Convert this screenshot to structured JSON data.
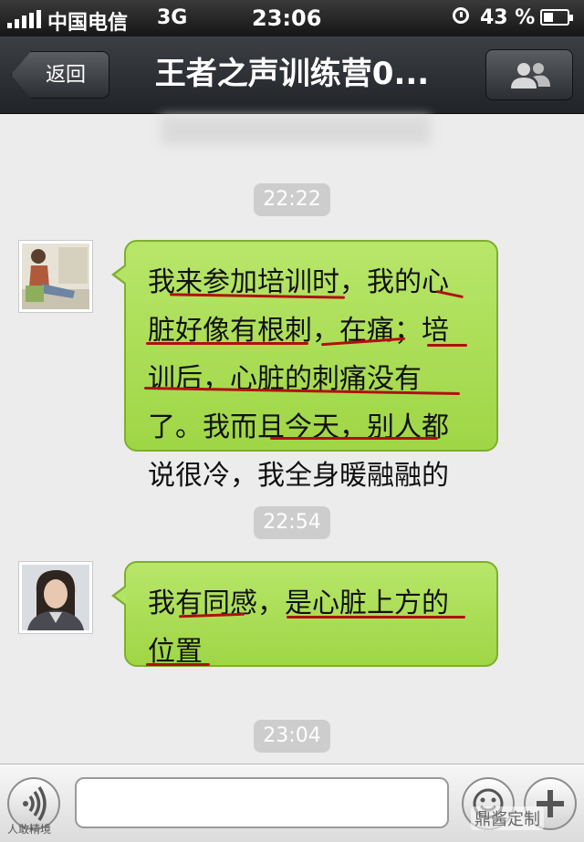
{
  "status_bar": {
    "carrier": "中国电信",
    "network": "3G",
    "time": "23:06",
    "battery": "43 %",
    "battery_level": 0.43
  },
  "nav": {
    "back_label": "返回",
    "title": "王者之声训练营0...",
    "members_icon": "group-icon"
  },
  "chat": {
    "messages": [
      {
        "timestamp": "22:22",
        "text": "我来参加培训时，我的心脏好像有根刺，在痛；培训后，心脏的刺痛没有了。我而且今天，别人都说很冷，我全身暖融融的"
      },
      {
        "timestamp": "22:54",
        "text": "我有同感，是心脏上方的位置"
      }
    ],
    "trailing_timestamp": "23:04"
  },
  "input_bar": {
    "placeholder": "",
    "voice_icon": "voice-icon",
    "emoji_icon": "emoji-icon",
    "plus_icon": "plus-icon"
  },
  "watermarks": {
    "left": "人敢精境",
    "right": "鼎酱定制"
  },
  "colors": {
    "bubble_green": "#a8dc52",
    "annotation_red": "#b01010",
    "nav_dark": "#2a2d31"
  }
}
